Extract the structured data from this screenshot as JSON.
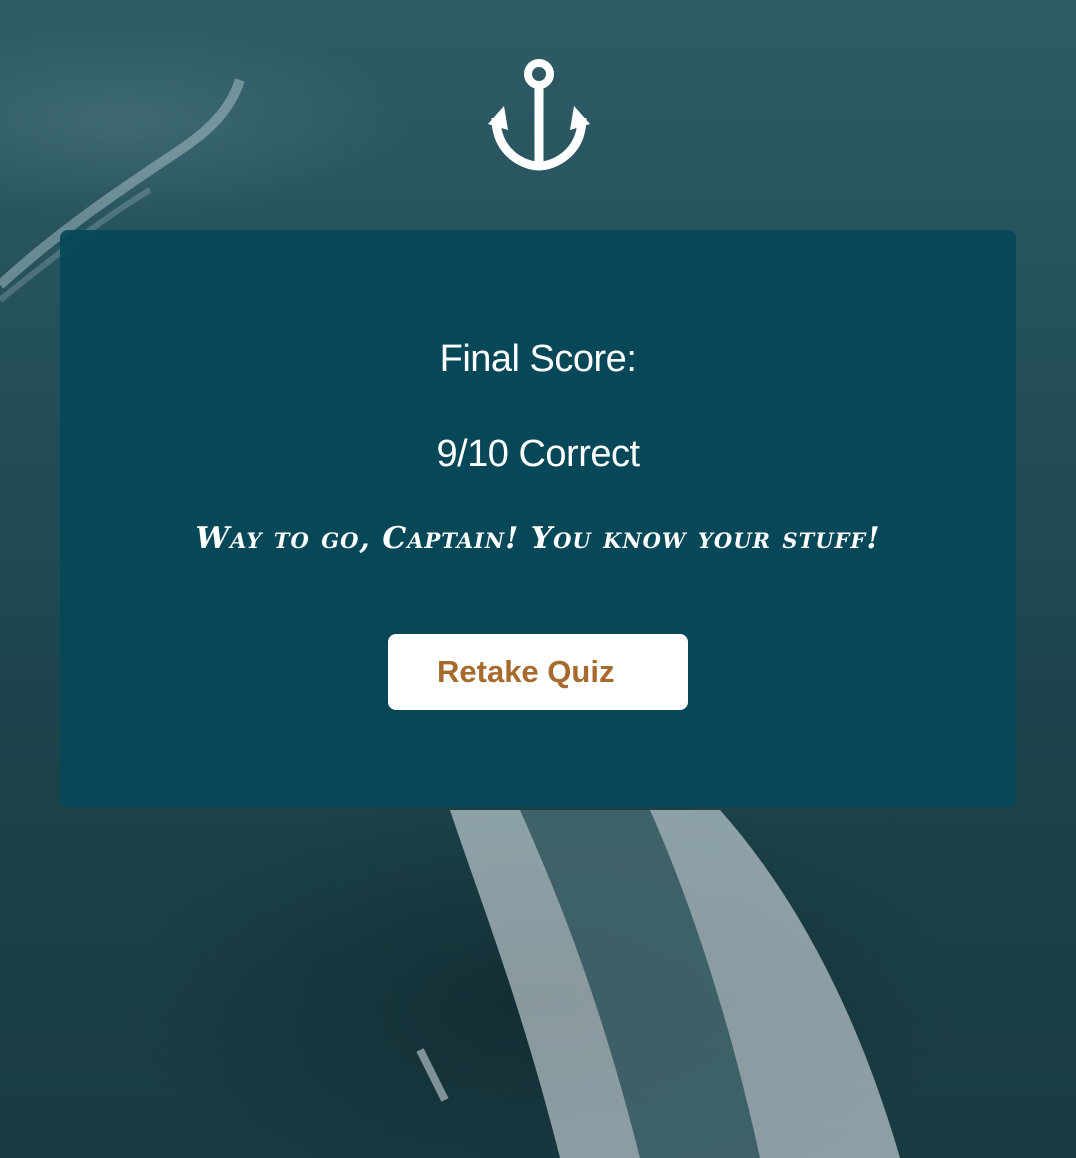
{
  "result": {
    "score_label": "Final Score:",
    "score_value": "9/10 Correct",
    "message": "Way to go, Captain! You know your stuff!"
  },
  "actions": {
    "retake_label": "Retake Quiz"
  },
  "icons": {
    "logo": "anchor-icon"
  },
  "colors": {
    "card": "#054858",
    "button_text": "#a56a2c",
    "text": "#ffffff"
  }
}
